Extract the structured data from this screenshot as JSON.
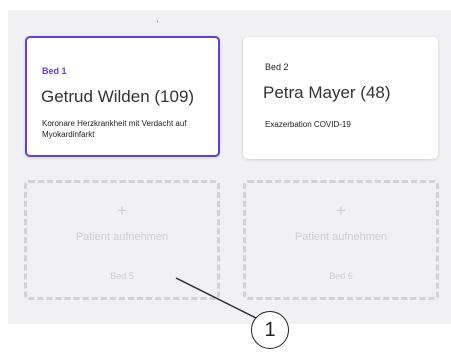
{
  "beds": [
    {
      "bed_label": "Bed 1",
      "patient_name": "Getrud Wilden (109)",
      "diagnosis": "Koronare Herzkrankheit mit Verdacht auf Myokardinfarkt",
      "selected": true,
      "accent_color": "#6a3fc0"
    },
    {
      "bed_label": "Bed 2",
      "patient_name": "Petra Mayer (48)",
      "diagnosis": "Exazerbation COVID-19",
      "selected": false
    }
  ],
  "empty_slots": [
    {
      "plus": "+",
      "action_label": "Patient aufnehmen",
      "bed_label": "Bed 5"
    },
    {
      "plus": "+",
      "action_label": "Patient aufnehmen",
      "bed_label": "Bed 6"
    }
  ],
  "callout": {
    "number": "1"
  }
}
